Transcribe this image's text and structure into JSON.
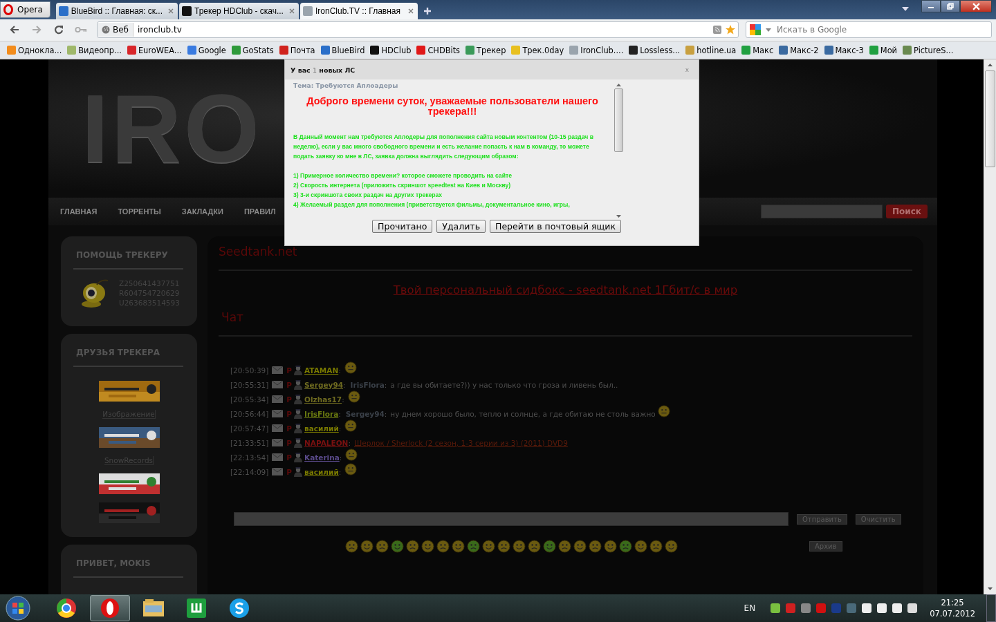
{
  "browser": {
    "menu_button": "Opera",
    "tabs": [
      {
        "title": "BlueBird :: Главная: ск...",
        "color": "#2a6fc9",
        "selected": false
      },
      {
        "title": "Трекер HDClub - скач...",
        "color": "#111111",
        "selected": false
      },
      {
        "title": "IronClub.TV :: Главная",
        "color": "#9aa4ad",
        "selected": true
      }
    ],
    "address_prefix": "Веб",
    "address": "ironclub.tv",
    "search_placeholder": "Искать в Google",
    "bookmarks": [
      {
        "label": "Однокла...",
        "color": "#f28c1c"
      },
      {
        "label": "Видеопр...",
        "color": "#9fb86a"
      },
      {
        "label": "EuroWEA...",
        "color": "#d8262a"
      },
      {
        "label": "Google",
        "color": "#3a7be0"
      },
      {
        "label": "GoStats",
        "color": "#2e9a3a"
      },
      {
        "label": "Почта",
        "color": "#d0221c"
      },
      {
        "label": "BlueBird",
        "color": "#2a6fc9"
      },
      {
        "label": "HDClub",
        "color": "#111111"
      },
      {
        "label": "CHDBits",
        "color": "#e01818"
      },
      {
        "label": "Трекер",
        "color": "#3a9a5a"
      },
      {
        "label": "Трек.0day",
        "color": "#e8c020"
      },
      {
        "label": "IronClub....",
        "color": "#9aa4ad"
      },
      {
        "label": "Lossless...",
        "color": "#222222"
      },
      {
        "label": "hotline.ua",
        "color": "#c8a040"
      },
      {
        "label": "Макс",
        "color": "#20a040"
      },
      {
        "label": "Макс-2",
        "color": "#3a6aa0"
      },
      {
        "label": "Макс-3",
        "color": "#3a6aa0"
      },
      {
        "label": "Мой",
        "color": "#20a040"
      },
      {
        "label": "PictureS...",
        "color": "#6a8a50"
      }
    ]
  },
  "header": {
    "logo": "IRO"
  },
  "nav": {
    "items": [
      "ГЛАВНАЯ",
      "ТОРРЕНТЫ",
      "ЗАКЛАДКИ",
      "ПРАВИЛ"
    ],
    "search_button": "Поиск"
  },
  "sidebar": [
    {
      "title": "ПОМОЩЬ ТРЕКЕРУ",
      "kind": "wallets",
      "lines": [
        "Z250641437751",
        "R604754720629",
        "U263683514593"
      ]
    },
    {
      "title": "ДРУЗЬЯ ТРЕКЕРА",
      "kind": "friends",
      "items": [
        {
          "kind": "picture"
        },
        {
          "kind": "link",
          "text": "Изображение"
        },
        {
          "kind": "picture"
        },
        {
          "kind": "link",
          "text": "SnowRecords"
        },
        {
          "kind": "picture"
        },
        {
          "kind": "picture"
        }
      ]
    },
    {
      "title": "ПРИВЕТ, MOKIS",
      "kind": "empty"
    }
  ],
  "main": {
    "title": "Seedtank.net",
    "ad_link": "Твой персональный сидбокс - seedtank.net 1Гбит/с в мир",
    "chat_title": "Чат",
    "messages": [
      {
        "time": "[20:50:39]",
        "mark": "P",
        "user": "ATAMAN",
        "user_sep": ":",
        "color": "#7a7a00",
        "smiley": true
      },
      {
        "time": "[20:55:31]",
        "mark": "P",
        "user": "Sergey94",
        "user_sep": ":",
        "color": "#6e6a20",
        "to": "IrisFlora",
        "to_sep": ":",
        "text": "а где вы обитаете?)) у нас только что гроза и ливень был..",
        "smiley": false
      },
      {
        "time": "[20:55:34]",
        "mark": "P",
        "user": "Olzhas17",
        "user_sep": ":",
        "color": "#6e6a20",
        "smiley": true
      },
      {
        "time": "[20:56:44]",
        "mark": "P",
        "user": "IrisFlora",
        "user_sep": ":",
        "color": "#6a7a10",
        "to": "Sergey94",
        "to_sep": ":",
        "text": "ну днем хорошо было, тепло и солнце, а где обитаю не столь важно",
        "smiley": true
      },
      {
        "time": "[20:57:47]",
        "mark": "P",
        "user": "василий",
        "user_sep": ":",
        "color": "#7a7a00",
        "smiley": true
      },
      {
        "time": "[21:33:51]",
        "mark": "P",
        "user": "NAPALEON",
        "user_sep": ":",
        "color": "#7a1010",
        "link": "Шерлок / Sherlock (2 сезон, 1-3 серии из 3) (2011) DVD9",
        "smiley": false
      },
      {
        "time": "[22:13:54]",
        "mark": "P",
        "user": "Katerina",
        "user_sep": ":",
        "color": "#5a4a8a",
        "smiley": true
      },
      {
        "time": "[22:14:09]",
        "mark": "P",
        "user": "василий",
        "user_sep": ":",
        "color": "#7a7a00",
        "smiley": true
      }
    ],
    "send_button": "Отправить",
    "clear_button": "Очистить",
    "archive_button": "Архив"
  },
  "modal": {
    "title_start": "У вас",
    "count": "1",
    "title_end": "новых ЛС",
    "close": "x",
    "subject": "Тема: Требуются Аплоадеры",
    "heading": "Доброго времени суток, уважаемые пользователи нашего трекера!!!",
    "paragraph": "В Данный момент нам требуются Аплодеры для пополнения сайта новым контентом (10-15 раздач в неделю), если у вас много свободного времени и есть желание попасть к нам в команду, то можете подать заявку ко мне в ЛС, заявка должна выглядить следующим образом:",
    "items": [
      "1) Примерное количество времени? которое сможете проводить на сайте",
      "2) Скорость интернета (приложить скриншот speedtest на Киев и Москву)",
      "3) 3-и скриншота своих раздач на других трекерах",
      "4) Желаемый раздел для пополнения (приветствуется фильмы, документальное кино, игры,"
    ],
    "buttons": [
      "Прочитано",
      "Удалить",
      "Перейти в почтовый ящик"
    ]
  },
  "taskbar": {
    "language": "EN",
    "time": "21:25",
    "date": "07.07.2012"
  }
}
